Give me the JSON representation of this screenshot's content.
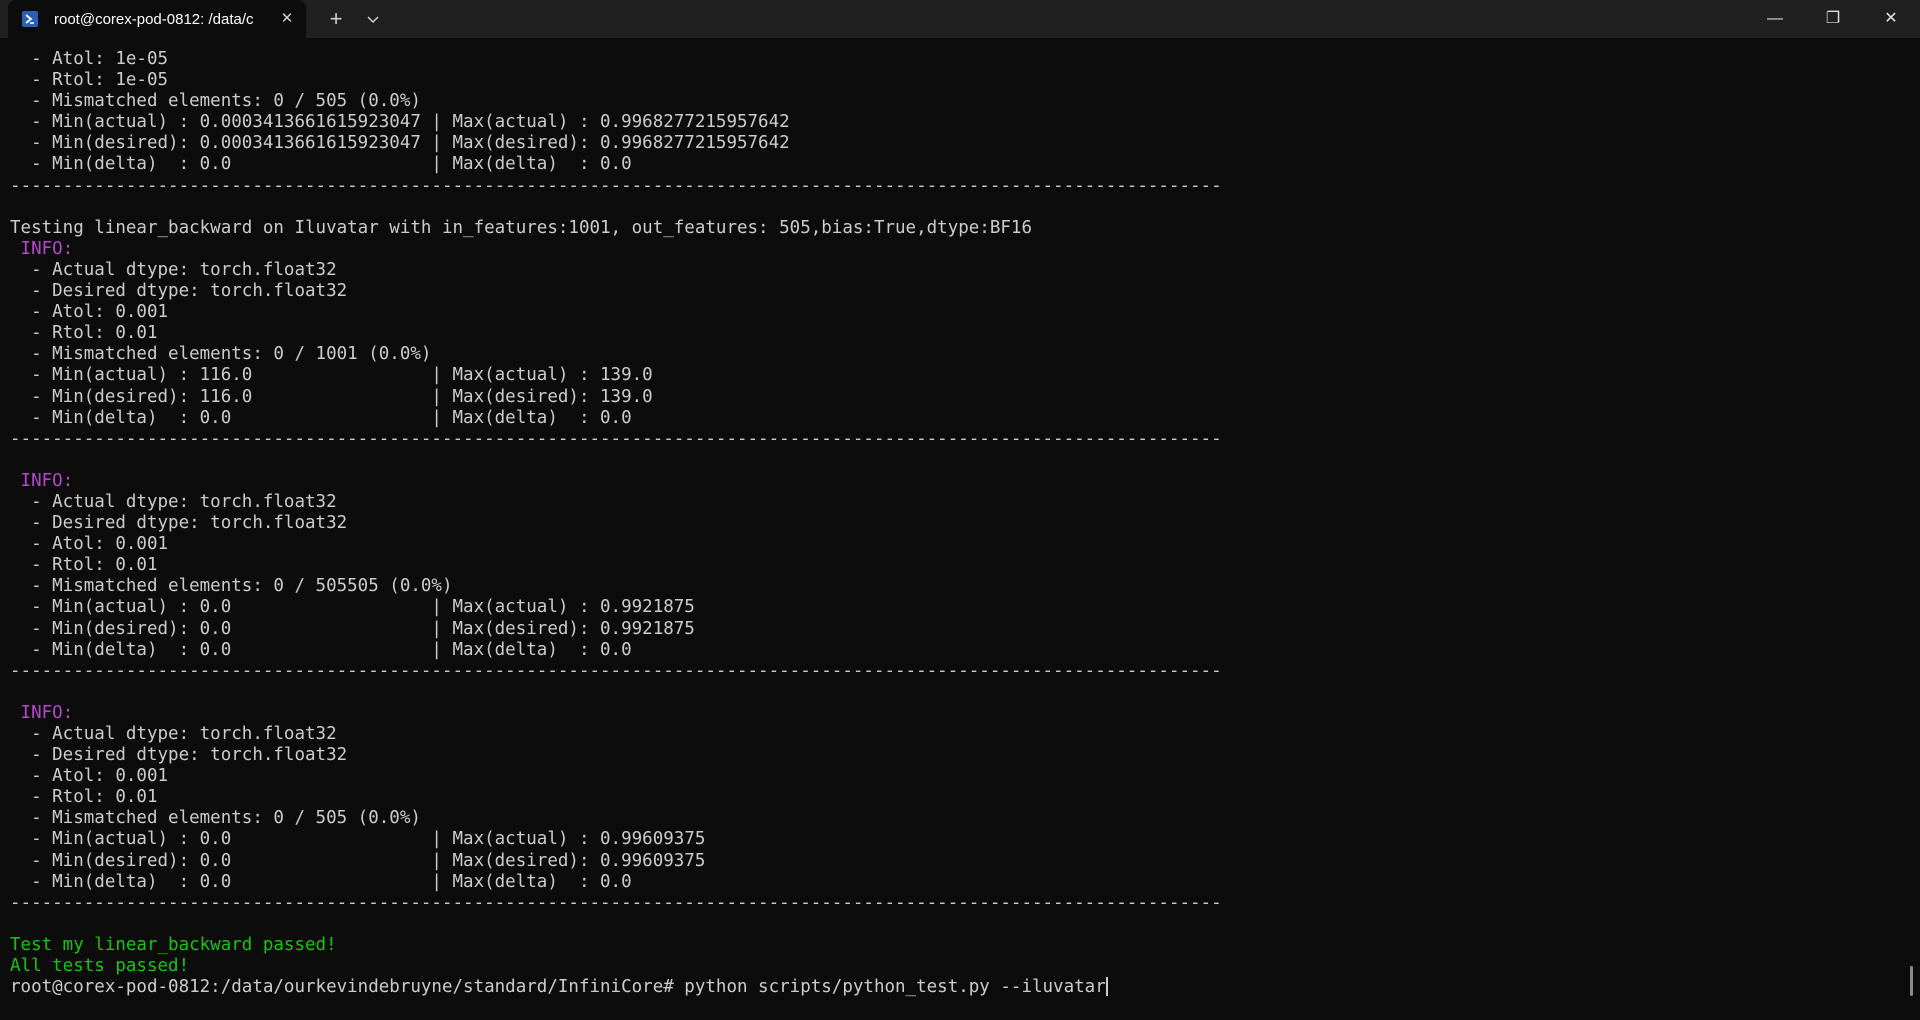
{
  "window": {
    "tab_title": "root@corex-pod-0812: /data/c",
    "tab_close_glyph": "✕",
    "new_tab_glyph": "+",
    "minimize_glyph": "—",
    "restore_glyph": "❐",
    "close_glyph": "✕",
    "icon": "powershell-icon"
  },
  "colors": {
    "background": "#0c0c0c",
    "text": "#cccccc",
    "info": "#b148c6",
    "success": "#16c60c",
    "titlebar": "#202020"
  },
  "terminal": {
    "lines": [
      {
        "text": "  - Atol: 1e-05",
        "kind": "normal"
      },
      {
        "text": "  - Rtol: 1e-05",
        "kind": "normal"
      },
      {
        "text": "  - Mismatched elements: 0 / 505 (0.0%)",
        "kind": "normal"
      },
      {
        "text": "  - Min(actual) : 0.0003413661615923047 | Max(actual) : 0.9968277215957642",
        "kind": "normal"
      },
      {
        "text": "  - Min(desired): 0.0003413661615923047 | Max(desired): 0.9968277215957642",
        "kind": "normal"
      },
      {
        "text": "  - Min(delta)  : 0.0                   | Max(delta)  : 0.0",
        "kind": "normal"
      },
      {
        "text": "-------------------------------------------------------------------------------------------------------------------",
        "kind": "normal"
      },
      {
        "text": "",
        "kind": "normal"
      },
      {
        "text": "Testing linear_backward on Iluvatar with in_features:1001, out_features: 505,bias:True,dtype:BF16",
        "kind": "normal"
      },
      {
        "text": " INFO:",
        "kind": "info"
      },
      {
        "text": "  - Actual dtype: torch.float32",
        "kind": "normal"
      },
      {
        "text": "  - Desired dtype: torch.float32",
        "kind": "normal"
      },
      {
        "text": "  - Atol: 0.001",
        "kind": "normal"
      },
      {
        "text": "  - Rtol: 0.01",
        "kind": "normal"
      },
      {
        "text": "  - Mismatched elements: 0 / 1001 (0.0%)",
        "kind": "normal"
      },
      {
        "text": "  - Min(actual) : 116.0                 | Max(actual) : 139.0",
        "kind": "normal"
      },
      {
        "text": "  - Min(desired): 116.0                 | Max(desired): 139.0",
        "kind": "normal"
      },
      {
        "text": "  - Min(delta)  : 0.0                   | Max(delta)  : 0.0",
        "kind": "normal"
      },
      {
        "text": "-------------------------------------------------------------------------------------------------------------------",
        "kind": "normal"
      },
      {
        "text": "",
        "kind": "normal"
      },
      {
        "text": " INFO:",
        "kind": "info"
      },
      {
        "text": "  - Actual dtype: torch.float32",
        "kind": "normal"
      },
      {
        "text": "  - Desired dtype: torch.float32",
        "kind": "normal"
      },
      {
        "text": "  - Atol: 0.001",
        "kind": "normal"
      },
      {
        "text": "  - Rtol: 0.01",
        "kind": "normal"
      },
      {
        "text": "  - Mismatched elements: 0 / 505505 (0.0%)",
        "kind": "normal"
      },
      {
        "text": "  - Min(actual) : 0.0                   | Max(actual) : 0.9921875",
        "kind": "normal"
      },
      {
        "text": "  - Min(desired): 0.0                   | Max(desired): 0.9921875",
        "kind": "normal"
      },
      {
        "text": "  - Min(delta)  : 0.0                   | Max(delta)  : 0.0",
        "kind": "normal"
      },
      {
        "text": "-------------------------------------------------------------------------------------------------------------------",
        "kind": "normal"
      },
      {
        "text": "",
        "kind": "normal"
      },
      {
        "text": " INFO:",
        "kind": "info"
      },
      {
        "text": "  - Actual dtype: torch.float32",
        "kind": "normal"
      },
      {
        "text": "  - Desired dtype: torch.float32",
        "kind": "normal"
      },
      {
        "text": "  - Atol: 0.001",
        "kind": "normal"
      },
      {
        "text": "  - Rtol: 0.01",
        "kind": "normal"
      },
      {
        "text": "  - Mismatched elements: 0 / 505 (0.0%)",
        "kind": "normal"
      },
      {
        "text": "  - Min(actual) : 0.0                   | Max(actual) : 0.99609375",
        "kind": "normal"
      },
      {
        "text": "  - Min(desired): 0.0                   | Max(desired): 0.99609375",
        "kind": "normal"
      },
      {
        "text": "  - Min(delta)  : 0.0                   | Max(delta)  : 0.0",
        "kind": "normal"
      },
      {
        "text": "-------------------------------------------------------------------------------------------------------------------",
        "kind": "normal"
      },
      {
        "text": "",
        "kind": "normal"
      },
      {
        "text": "Test my linear_backward passed!",
        "kind": "success"
      },
      {
        "text": "All tests passed!",
        "kind": "success"
      }
    ],
    "prompt": "root@corex-pod-0812:/data/ourkevindebruyne/standard/InfiniCore# ",
    "command": "python scripts/python_test.py --iluvatar"
  }
}
